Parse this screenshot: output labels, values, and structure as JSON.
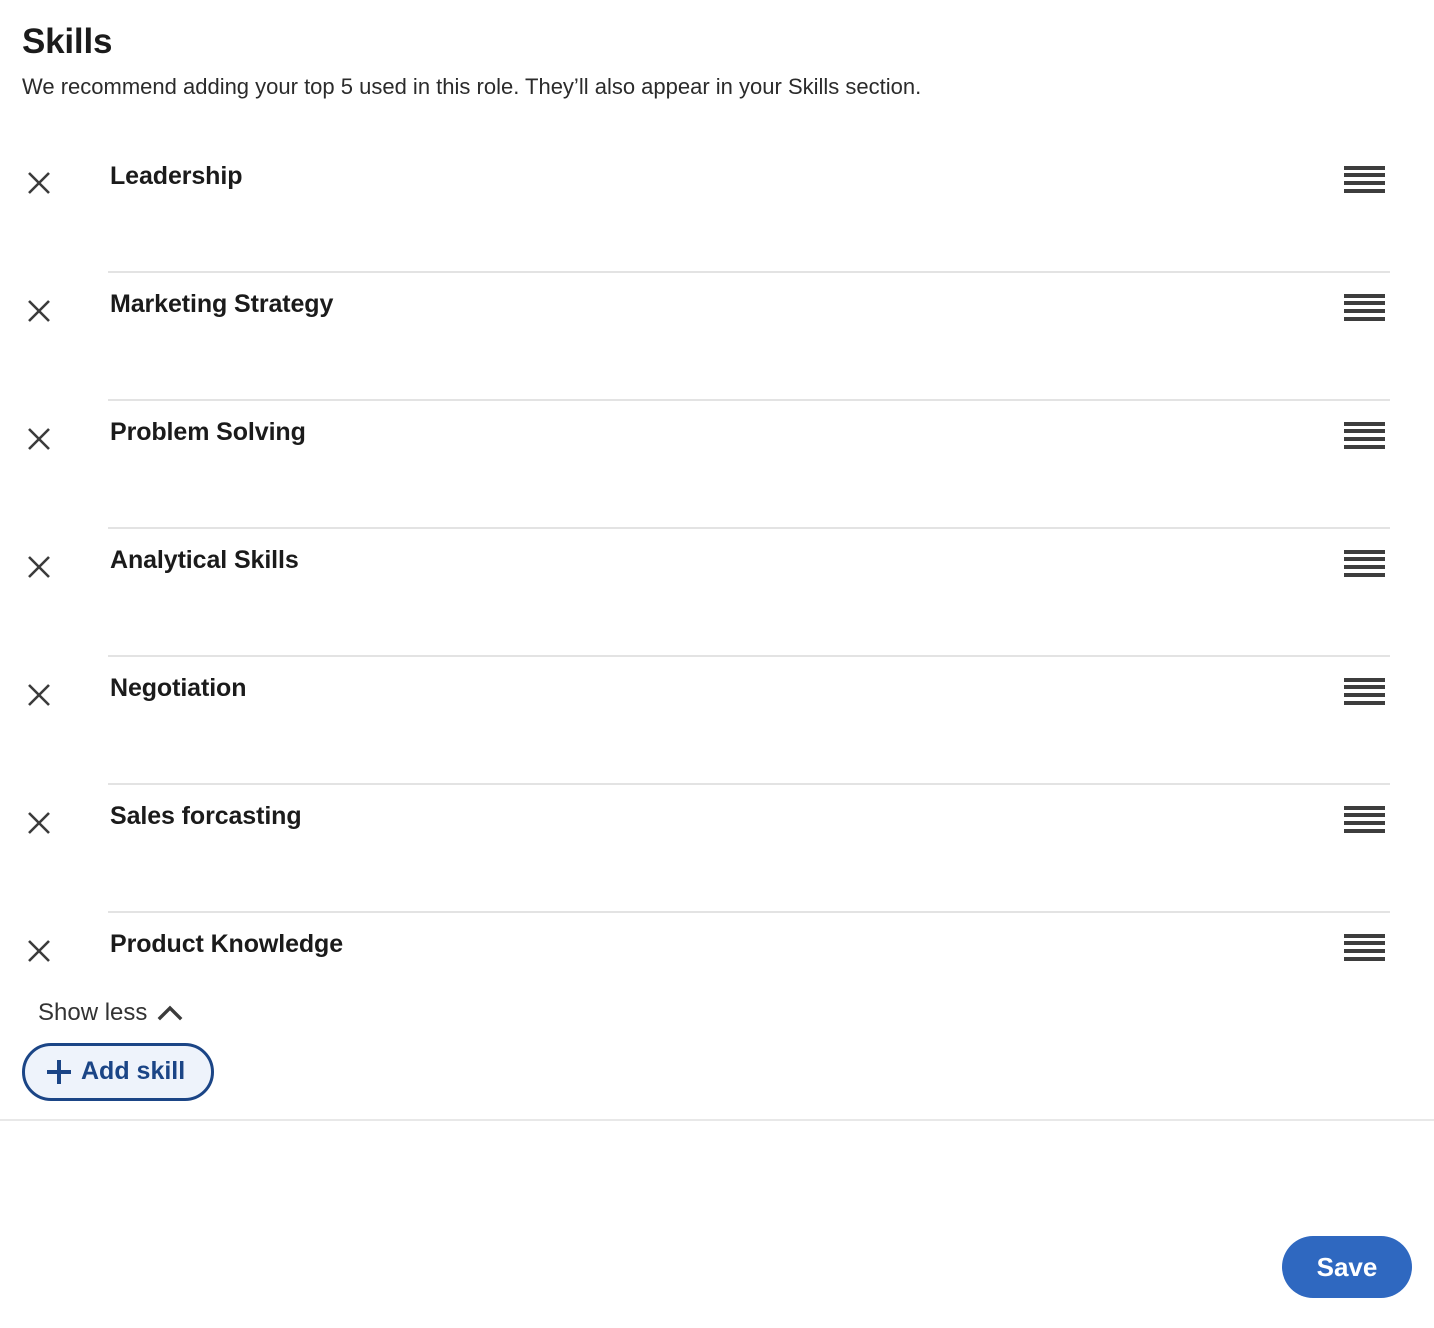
{
  "section": {
    "title": "Skills",
    "subtitle": "We recommend adding your top 5 used in this role. They’ll also appear in your Skills section."
  },
  "skills": [
    {
      "label": "Leadership",
      "remove_icon": "close-icon",
      "drag_icon": "drag-handle-icon"
    },
    {
      "label": "Marketing Strategy",
      "remove_icon": "close-icon",
      "drag_icon": "drag-handle-icon"
    },
    {
      "label": "Problem Solving",
      "remove_icon": "close-icon",
      "drag_icon": "drag-handle-icon"
    },
    {
      "label": "Analytical Skills",
      "remove_icon": "close-icon",
      "drag_icon": "drag-handle-icon"
    },
    {
      "label": "Negotiation",
      "remove_icon": "close-icon",
      "drag_icon": "drag-handle-icon"
    },
    {
      "label": "Sales forcasting",
      "remove_icon": "close-icon",
      "drag_icon": "drag-handle-icon"
    },
    {
      "label": "Product Knowledge",
      "remove_icon": "close-icon",
      "drag_icon": "drag-handle-icon"
    }
  ],
  "show_toggle": {
    "label": "Show less",
    "icon": "chevron-up-icon"
  },
  "add_skill": {
    "label": "Add skill",
    "icon": "plus-icon"
  },
  "footer": {
    "save_label": "Save"
  },
  "colors": {
    "save_button_bg": "#2f68c0",
    "save_button_text": "#ffffff",
    "add_skill_border": "#1b4586",
    "add_skill_bg": "#eef3fb",
    "add_skill_text": "#1b4586",
    "divider": "#e3e3e3",
    "text_primary": "#1b1b1b",
    "icon": "#3b3b3b"
  }
}
